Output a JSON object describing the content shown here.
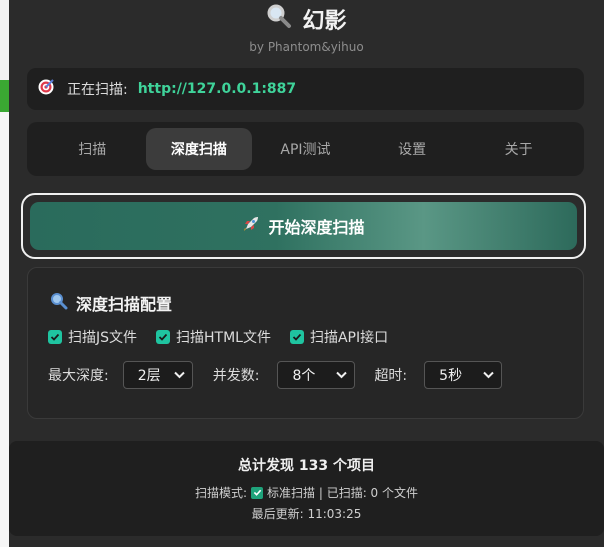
{
  "app": {
    "title": "幻影",
    "subtitle": "by Phantom&yihuo"
  },
  "status": {
    "label": "正在扫描:",
    "url": "http://127.0.0.1:887"
  },
  "tabs": [
    {
      "label": "扫描",
      "active": false
    },
    {
      "label": "深度扫描",
      "active": true
    },
    {
      "label": "API测试",
      "active": false
    },
    {
      "label": "设置",
      "active": false
    },
    {
      "label": "关于",
      "active": false
    }
  ],
  "start_button": {
    "label": "开始深度扫描",
    "icon": "rocket-icon"
  },
  "config": {
    "title": "深度扫描配置",
    "checks": [
      {
        "label": "扫描JS文件",
        "checked": true
      },
      {
        "label": "扫描HTML文件",
        "checked": true
      },
      {
        "label": "扫描API接口",
        "checked": true
      }
    ],
    "depth": {
      "label": "最大深度:",
      "value": "2层"
    },
    "concurrency": {
      "label": "并发数:",
      "value": "8个"
    },
    "timeout": {
      "label": "超时:",
      "value": "5秒"
    }
  },
  "footer": {
    "total_prefix": "总计发现",
    "total_count": "133",
    "total_suffix": "个项目",
    "mode_label": "扫描模式:",
    "mode_value": "标准扫描 | 已扫描: 0 个文件",
    "updated": "最后更新: 11:03:25"
  },
  "colors": {
    "accent": "#3fd39a",
    "button": "#2f7160",
    "background": "#2b2b2b"
  }
}
